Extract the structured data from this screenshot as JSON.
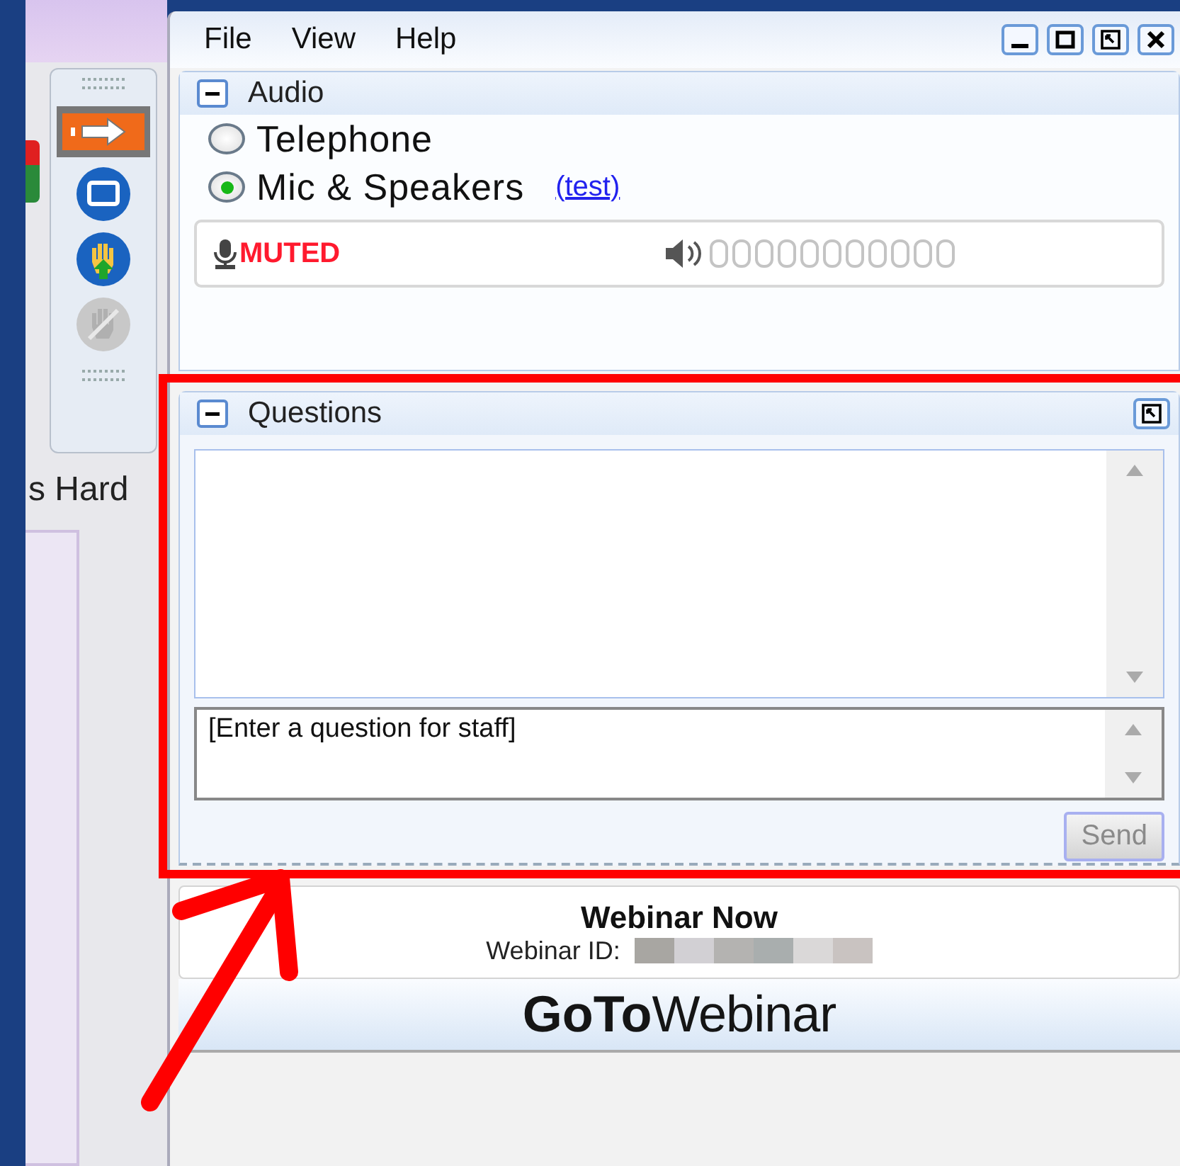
{
  "background_window": {
    "toolbar": [
      {
        "kind": "arrow",
        "selected": true,
        "disabled": false
      },
      {
        "kind": "screen",
        "selected": false,
        "disabled": false
      },
      {
        "kind": "hand",
        "selected": false,
        "disabled": false
      },
      {
        "kind": "hand",
        "selected": false,
        "disabled": true
      }
    ],
    "text": "s Hard"
  },
  "menu": [
    {
      "label": "File"
    },
    {
      "label": "View"
    },
    {
      "label": "Help"
    }
  ],
  "audio": {
    "title": "Audio",
    "expanded": true,
    "options": [
      {
        "label": "Telephone",
        "selected": false
      },
      {
        "label": "Mic & Speakers",
        "selected": true
      }
    ],
    "test_link": "(test)",
    "mic_status": "MUTED"
  },
  "questions": {
    "title": "Questions",
    "expanded": true,
    "input": {
      "placeholder": "[Enter a question for staff]"
    },
    "send": {
      "label": "Send",
      "disabled": true
    }
  },
  "webinar": {
    "title": "Webinar Now",
    "id_label": "Webinar ID:"
  },
  "logo": "**GoTo**Webinar"
}
